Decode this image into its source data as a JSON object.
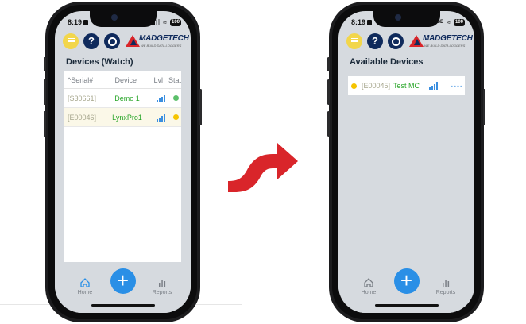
{
  "left_phone": {
    "status": {
      "time": "8:19",
      "battery": "100"
    },
    "title": "Devices (Watch)",
    "columns": [
      "^Serial#",
      "Device",
      "Lvl",
      "Stat"
    ],
    "rows": [
      {
        "serial": "[S30661]",
        "device": "Demo 1",
        "stat_color": "#5bbf6a"
      },
      {
        "serial": "[E00046]",
        "device": "LynxPro1",
        "stat_color": "#f5c400"
      }
    ],
    "tabs": {
      "home": "Home",
      "reports": "Reports"
    }
  },
  "right_phone": {
    "status": {
      "time": "8:19",
      "network": "5GE",
      "battery": "100"
    },
    "title": "Available Devices",
    "device": {
      "serial": "[E00045]",
      "name": "Test MC",
      "stat": "----",
      "dot_color": "#f5c400"
    },
    "tabs": {
      "home": "Home",
      "reports": "Reports"
    }
  },
  "logo": {
    "name": "MADGETECH",
    "tagline": "WE BUILD DATA LOGGERS"
  },
  "icons": {
    "menu": "menu-icon",
    "help": "help-icon",
    "search": "search-icon",
    "home": "home-icon",
    "reports": "reports-icon",
    "add": "plus-icon",
    "arrow": "curved-arrow-icon"
  },
  "colors": {
    "accent": "#2a8fe6",
    "brand_red": "#d9252a",
    "brand_navy": "#0f2a5c",
    "device_green": "#2aa62a",
    "arrow": "#d9252a"
  }
}
